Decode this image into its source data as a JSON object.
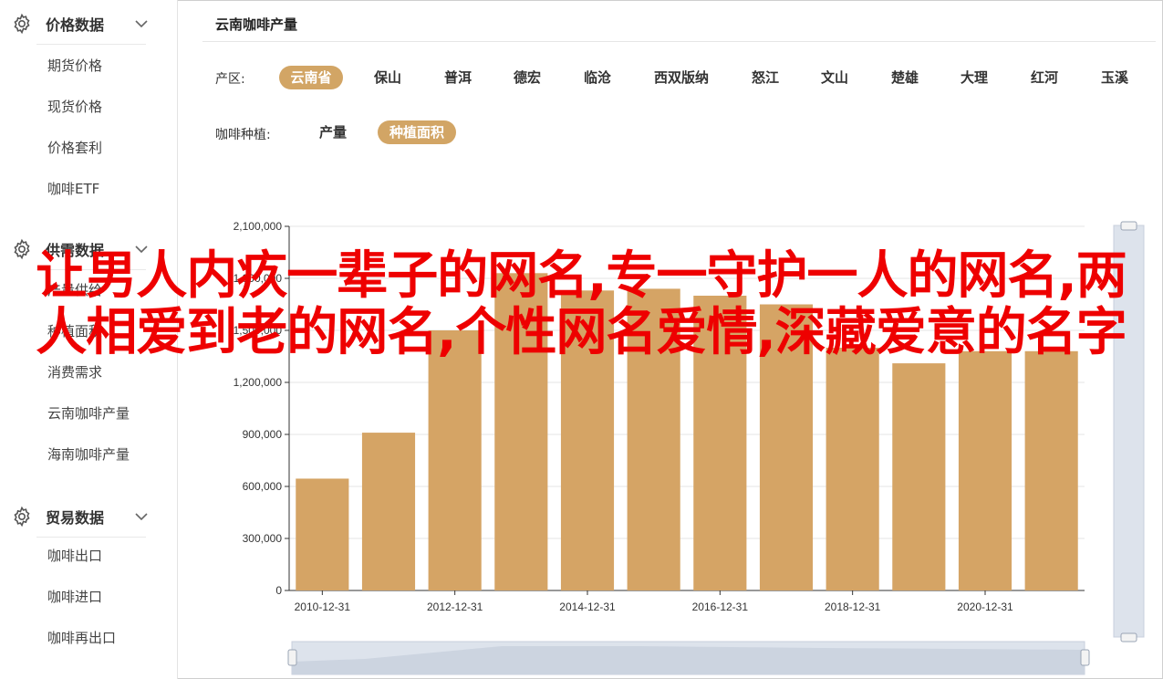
{
  "sidebar": {
    "sections": [
      {
        "title": "价格数据",
        "icon": "gear-icon",
        "items": [
          "期货价格",
          "现货价格",
          "价格套利",
          "咖啡ETF"
        ]
      },
      {
        "title": "供需数据",
        "icon": "gear-icon",
        "items": [
          "产量供给",
          "种植面积",
          "消费需求",
          "云南咖啡产量",
          "海南咖啡产量"
        ]
      },
      {
        "title": "贸易数据",
        "icon": "gear-icon",
        "items": [
          "咖啡出口",
          "咖啡进口",
          "咖啡再出口"
        ]
      }
    ]
  },
  "main": {
    "title": "云南咖啡产量",
    "region_label": "产区:",
    "regions": [
      "云南省",
      "保山",
      "普洱",
      "德宏",
      "临沧",
      "西双版纳",
      "怒江",
      "文山",
      "楚雄",
      "大理",
      "红河",
      "玉溪"
    ],
    "active_region": "云南省",
    "type_label": "咖啡种植:",
    "types": [
      "产量",
      "种植面积"
    ],
    "active_type": "种植面积"
  },
  "colors": {
    "accent": "#d2a565",
    "bar": "#d5a465",
    "overlay_text": "#ee0000"
  },
  "chart_data": {
    "type": "bar",
    "categories": [
      "2010-12-31",
      "2011-12-31",
      "2012-12-31",
      "2013-12-31",
      "2014-12-31",
      "2015-12-31",
      "2016-12-31",
      "2017-12-31",
      "2018-12-31",
      "2019-12-31",
      "2020-12-31",
      "2021-12-31"
    ],
    "values": [
      645000,
      910000,
      1500000,
      1830000,
      1730000,
      1740000,
      1700000,
      1650000,
      1400000,
      1310000,
      1380000,
      1380000
    ],
    "x_tick_labels": [
      "2010-12-31",
      "2012-12-31",
      "2014-12-31",
      "2016-12-31",
      "2018-12-31",
      "2020-12-31"
    ],
    "y_ticks": [
      "0",
      "300,000",
      "600,000",
      "900,000",
      "1,200,000",
      "1,500,000",
      "1,800,000",
      "2,100,000"
    ],
    "ylim": [
      0,
      2100000
    ],
    "grid": true
  },
  "overlay": {
    "text": "让男人内疚一辈子的网名,专一守护一人的网名,两人相爱到老的网名,个性网名爱情,深藏爱意的名字"
  }
}
